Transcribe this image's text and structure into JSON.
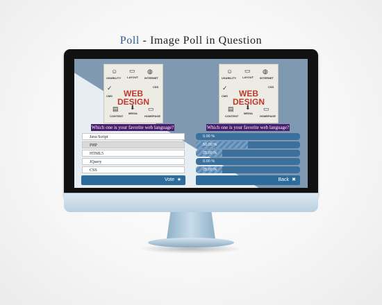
{
  "header": {
    "accent": "Poll",
    "rest": " - Image Poll in Question"
  },
  "poll_image": {
    "labels": [
      "USABILITY",
      "LAYOUT",
      "INTERNET",
      "CMS",
      "CSS",
      "CONTENT",
      "MEDIA",
      "HOMEPAGE"
    ],
    "word1": "WEB",
    "word2": "DESIGN"
  },
  "question": "Which one is your favorite web language?",
  "options": [
    "Java Script",
    "PHP",
    "HTML5",
    "JQuery",
    "CSS"
  ],
  "vote_label": "Vote",
  "back_label": "Back",
  "results": [
    {
      "value": "0.00 %",
      "pct": 0
    },
    {
      "value": "50.00 %",
      "pct": 50
    },
    {
      "value": "25.00 %",
      "pct": 25
    },
    {
      "value": "0.00 %",
      "pct": 0
    },
    {
      "value": "25.00 %",
      "pct": 25
    }
  ]
}
